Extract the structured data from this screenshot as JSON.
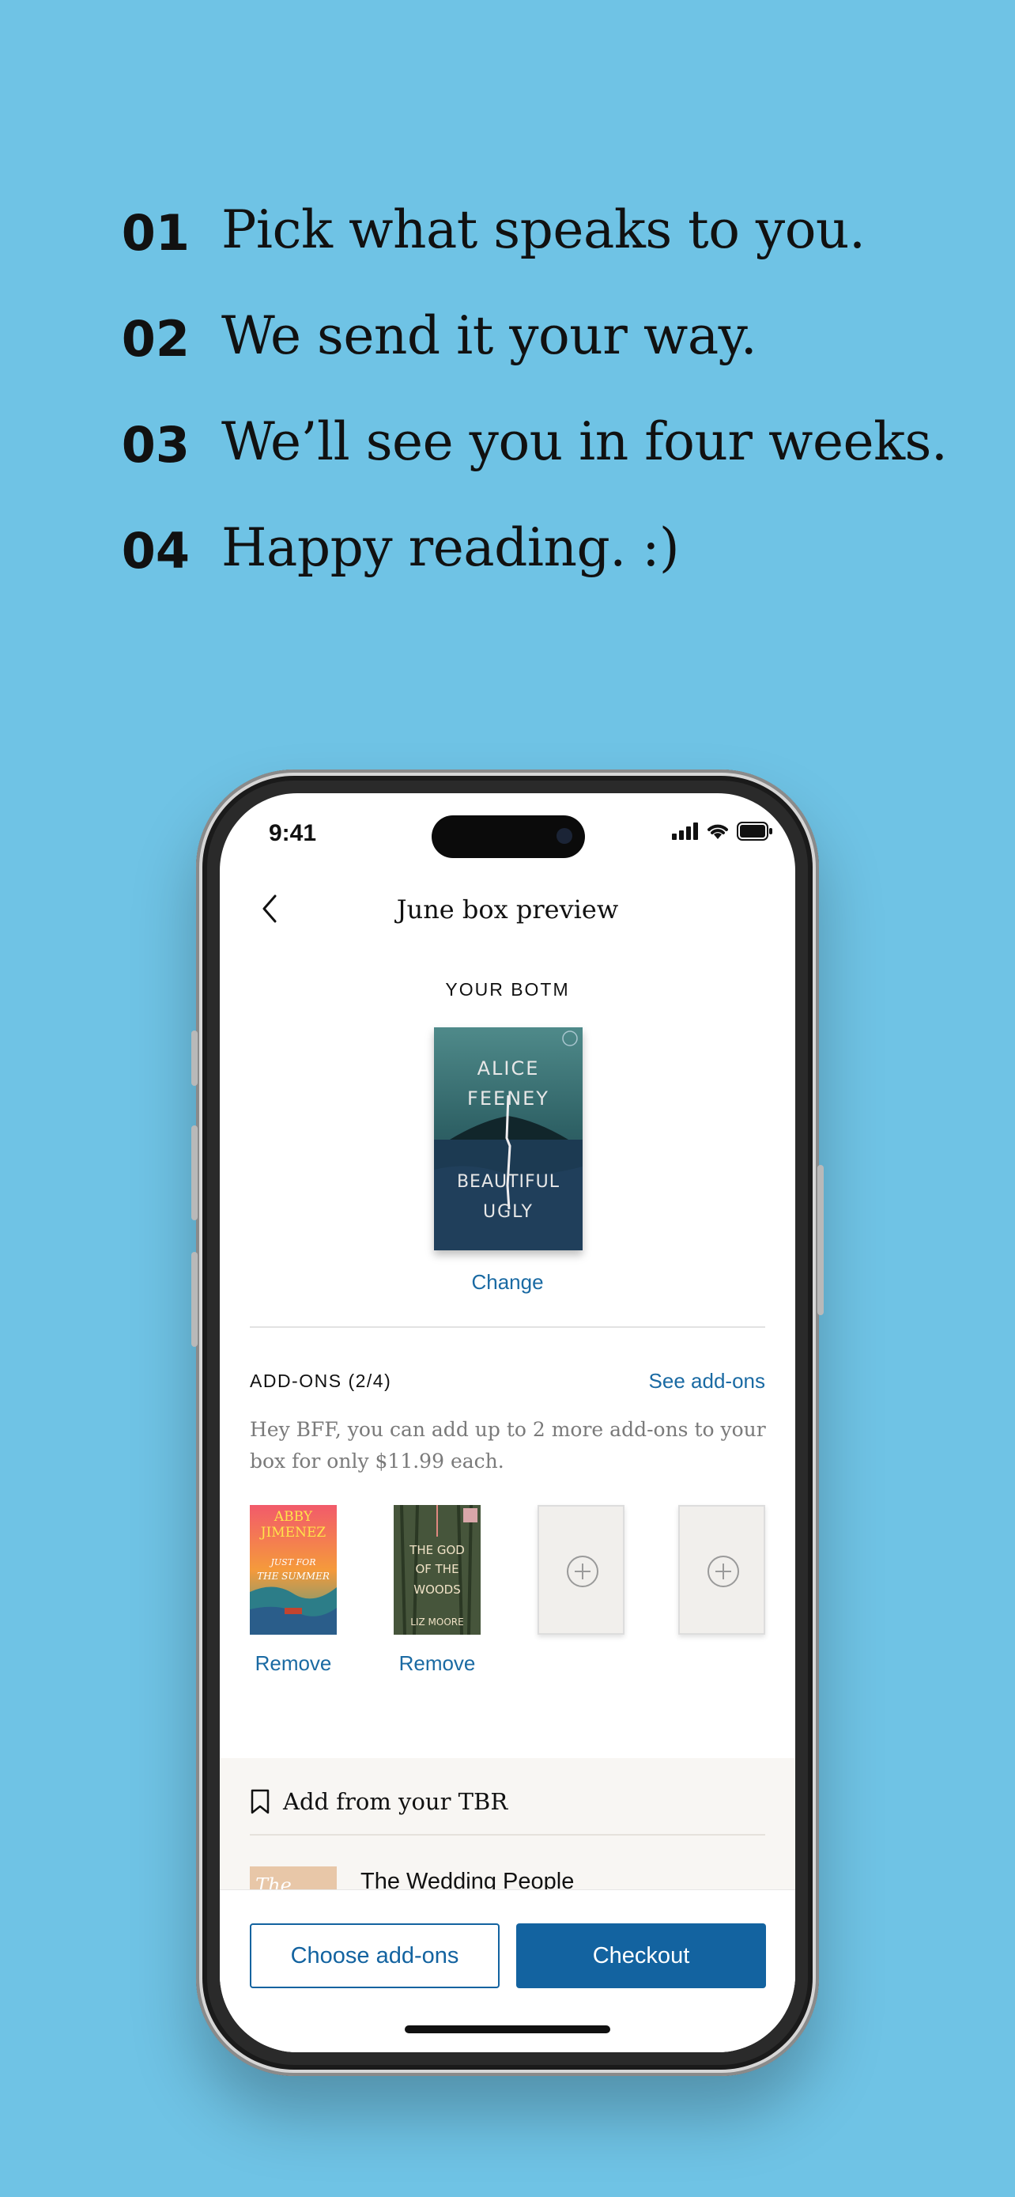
{
  "steps": [
    {
      "num": "01",
      "text": "Pick what speaks to you."
    },
    {
      "num": "02",
      "text": "We send it your way."
    },
    {
      "num": "03",
      "text": "We’ll see you in four weeks."
    },
    {
      "num": "04",
      "text": "Happy reading. :)"
    }
  ],
  "status": {
    "time": "9:41"
  },
  "nav": {
    "title": "June box preview",
    "back_icon": "chevron-left-icon"
  },
  "your_botm": {
    "label": "YOUR BOTM",
    "cover": {
      "author_line1": "ALICE",
      "author_line2": "FEENEY",
      "title_line1": "BEAUTIFUL",
      "title_line2": "UGLY"
    },
    "change_label": "Change"
  },
  "addons": {
    "heading": "ADD-ONS (2/4)",
    "see_label": "See add-ons",
    "description": "Hey BFF, you can add up to 2 more add-ons to your box for only $11.99 each.",
    "books": [
      {
        "cover_line1": "ABBY",
        "cover_line2": "JIMENEZ",
        "cover_line3": "JUST FOR",
        "cover_line4": "THE SUMMER",
        "remove_label": "Remove"
      },
      {
        "cover_line1": "THE GOD",
        "cover_line2": "OF THE",
        "cover_line3": "WOODS",
        "cover_line4": "LIZ MOORE",
        "remove_label": "Remove"
      }
    ],
    "empty_slot_icon": "plus-circle-icon"
  },
  "tbr": {
    "heading": "Add from your TBR",
    "icon": "bookmark-icon",
    "book_title": "The Wedding People",
    "book_cover_text": "The"
  },
  "actions": {
    "choose_label": "Choose add-ons",
    "checkout_label": "Checkout"
  },
  "colors": {
    "background": "#6fc3e5",
    "accent": "#1363a0",
    "link": "#1a6aa3"
  }
}
